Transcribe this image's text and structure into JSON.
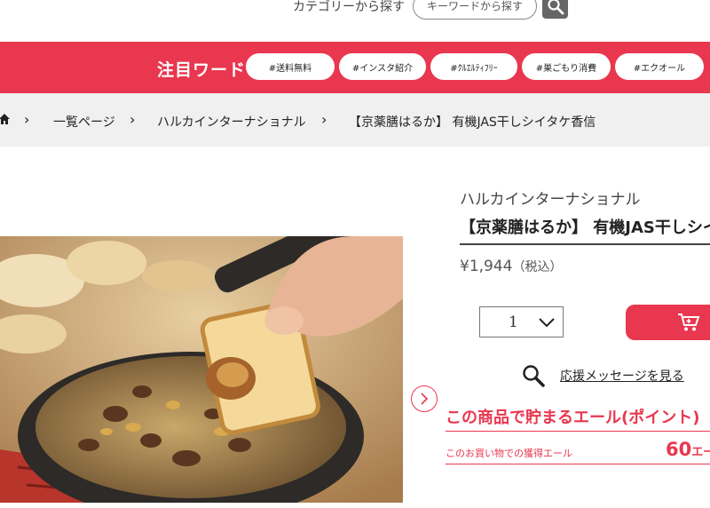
{
  "header": {
    "category_link": "カテゴリーから探す",
    "keyword_button": "キーワードから探す"
  },
  "banner": {
    "title": "注目ワード",
    "chips": [
      "#送料無料",
      "#インスタ紹介",
      "#ｸﾙｴﾙﾃｨﾌﾘｰ",
      "#巣ごもり消費",
      "#エクオール"
    ]
  },
  "breadcrumb": {
    "items": [
      "一覧ページ",
      "ハルカインターナショナル",
      "【京薬膳はるか】 有機JAS干しシイタケ香信"
    ]
  },
  "product": {
    "brand": "ハルカインターナショナル",
    "title": "【京薬膳はるか】 有機JAS干しシイタケ香信",
    "price": "¥1,944",
    "tax_note": "（税込）",
    "quantity": "1",
    "message_link": "応援メッセージを見る",
    "yell_title": "この商品で貯まるエール(ポイント)",
    "yell_label": "このお買い物での獲得エール",
    "yell_points": "60",
    "yell_unit": "エール"
  },
  "colors": {
    "accent": "#e9374f",
    "breadcrumb_bg": "#f0f0f0"
  },
  "icons": [
    "search-icon",
    "home-icon",
    "chevron-right-icon",
    "chevron-down-icon",
    "cart-icon"
  ]
}
